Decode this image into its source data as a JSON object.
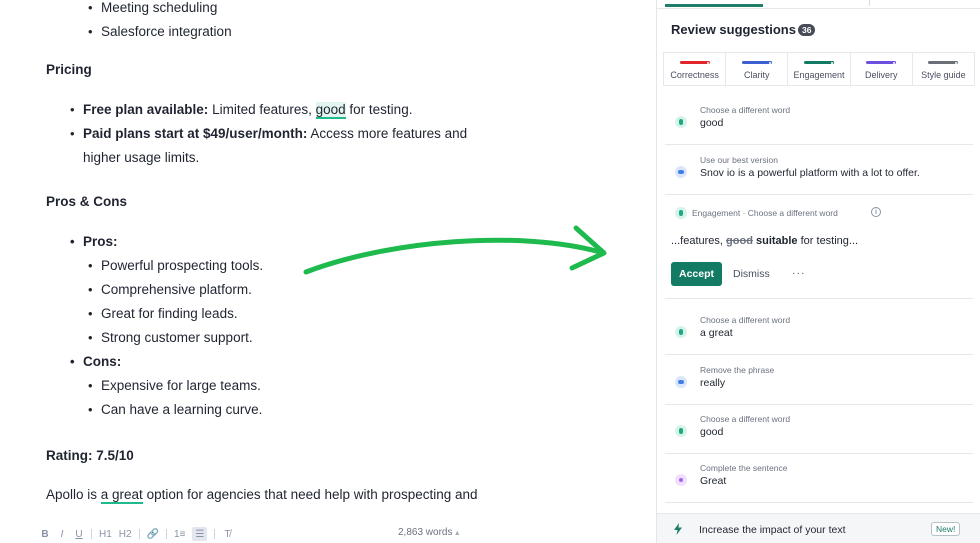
{
  "editor": {
    "top_list": [
      "Meeting scheduling",
      "Salesforce integration"
    ],
    "pricing": {
      "title": "Pricing",
      "items": [
        {
          "bold": "Free plan available:",
          "before": " Limited features, ",
          "highlight": "good",
          "after": " for testing."
        },
        {
          "bold": "Paid plans start at $49/user/month:",
          "text": " Access more features and higher usage limits."
        }
      ]
    },
    "pros_cons": {
      "title": "Pros & Cons",
      "pros_label": "Pros:",
      "pros": [
        "Powerful prospecting tools.",
        "Comprehensive platform.",
        "Great for finding leads.",
        "Strong customer support."
      ],
      "cons_label": "Cons:",
      "cons": [
        "Expensive for large teams.",
        "Can have a learning curve."
      ]
    },
    "rating": "Rating: 7.5/10",
    "paragraph": {
      "before": "Apollo is ",
      "underline": "a great",
      "after": " option for agencies that need help with prospecting and"
    },
    "toolbar": {
      "bold": "B",
      "italic": "I",
      "underline": "U",
      "h1": "H1",
      "h2": "H2",
      "link": "🔗",
      "ordered_list": "1≡",
      "bullet_list": "☰",
      "clear": "T̸"
    },
    "word_count": "2,863 words",
    "word_count_caret": "▴"
  },
  "panel": {
    "title": "Review suggestions",
    "count": "36",
    "categories": [
      {
        "label": "Correctness",
        "color": "#e0262b"
      },
      {
        "label": "Clarity",
        "color": "#3b5fd1"
      },
      {
        "label": "Engagement",
        "color": "#137a63"
      },
      {
        "label": "Delivery",
        "color": "#6b4fe0"
      },
      {
        "label": "Style guide",
        "color": "#6b6f78"
      }
    ],
    "suggestions_top": [
      {
        "caption": "Choose a different word",
        "value": "good",
        "dot": "green"
      },
      {
        "caption": "Use our best version",
        "value": "Snov io is a powerful platform with a lot to offer.",
        "dot": "blue"
      }
    ],
    "expanded": {
      "caption": "Engagement · Choose a different word",
      "info": "i",
      "prefix": "...features, ",
      "struck": "good",
      "replacement": "suitable",
      "suffix": " for testing...",
      "accept": "Accept",
      "dismiss": "Dismiss",
      "more": "···"
    },
    "suggestions_bottom": [
      {
        "caption": "Choose a different word",
        "value": "a great",
        "dot": "green"
      },
      {
        "caption": "Remove the phrase",
        "value": "really",
        "dot": "blue"
      },
      {
        "caption": "Choose a different word",
        "value": "good",
        "dot": "green"
      },
      {
        "caption": "Complete the sentence",
        "value": "Great",
        "dot": "purple"
      }
    ],
    "footer": {
      "text": "Increase the impact of your text",
      "badge": "New!"
    }
  },
  "colors": {
    "accent": "#137a63",
    "arrow": "#1fba4e",
    "highlight": "#1fbb8f"
  }
}
